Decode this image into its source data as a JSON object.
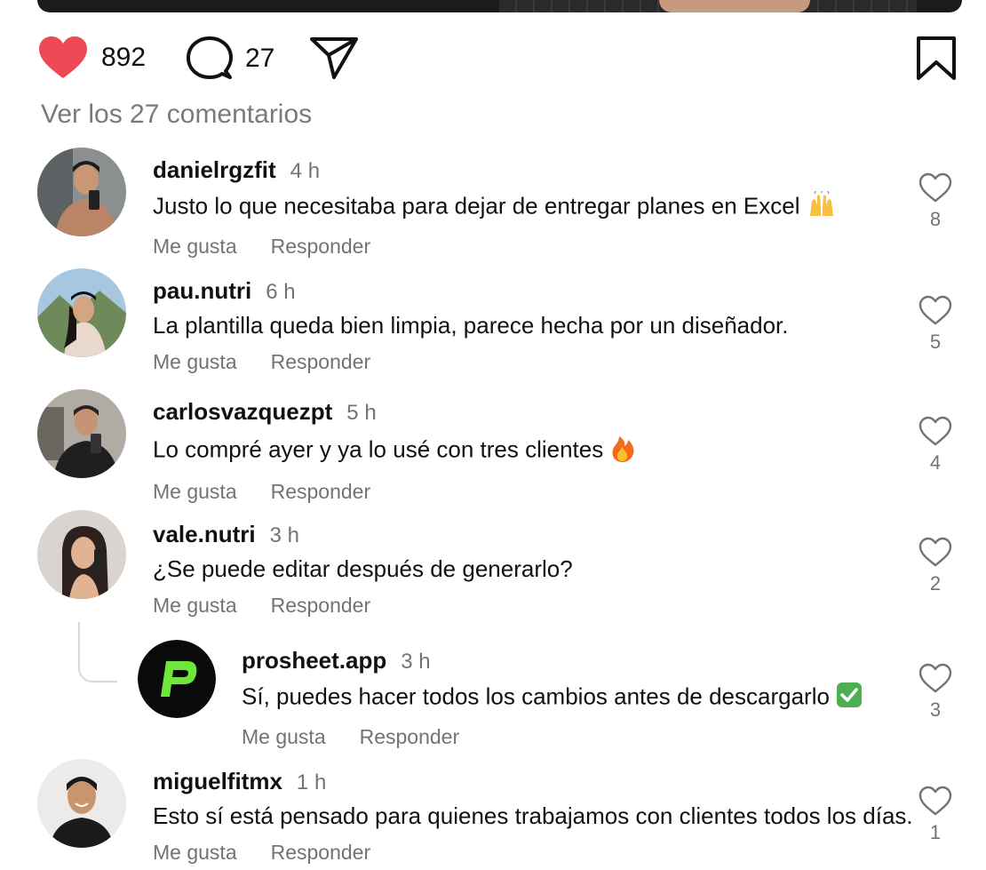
{
  "post": {
    "likes": "892",
    "comments_count": "27",
    "view_all": "Ver los 27 comentarios"
  },
  "labels": {
    "like": "Me gusta",
    "reply": "Responder"
  },
  "comments": [
    {
      "username": "danielrgzfit",
      "time": "4 h",
      "text": "Justo lo que necesitaba para dejar de entregar planes en Excel",
      "emoji": "raising-hands",
      "likes": "8"
    },
    {
      "username": "pau.nutri",
      "time": "6 h",
      "text": "La plantilla queda bien limpia, parece hecha por un diseñador.",
      "likes": "5"
    },
    {
      "username": "carlosvazquezpt",
      "time": "5 h",
      "text": "Lo compré ayer y ya lo usé con tres clientes",
      "emoji": "fire",
      "likes": "4"
    },
    {
      "username": "vale.nutri",
      "time": "3 h",
      "text": "¿Se puede editar después de generarlo?",
      "likes": "2"
    },
    {
      "username": "prosheet.app",
      "time": "3 h",
      "text": "Sí, puedes hacer todos los cambios antes de descargarlo",
      "emoji": "check-mark",
      "likes": "3"
    },
    {
      "username": "miguelfitmx",
      "time": "1 h",
      "text": "Esto sí está pensado para quienes trabajamos con clientes todos los días.",
      "likes": "1"
    }
  ],
  "colors": {
    "heart_filled": "#ed4956",
    "muted_text": "#737373",
    "brand_green": "#6ee63b"
  }
}
